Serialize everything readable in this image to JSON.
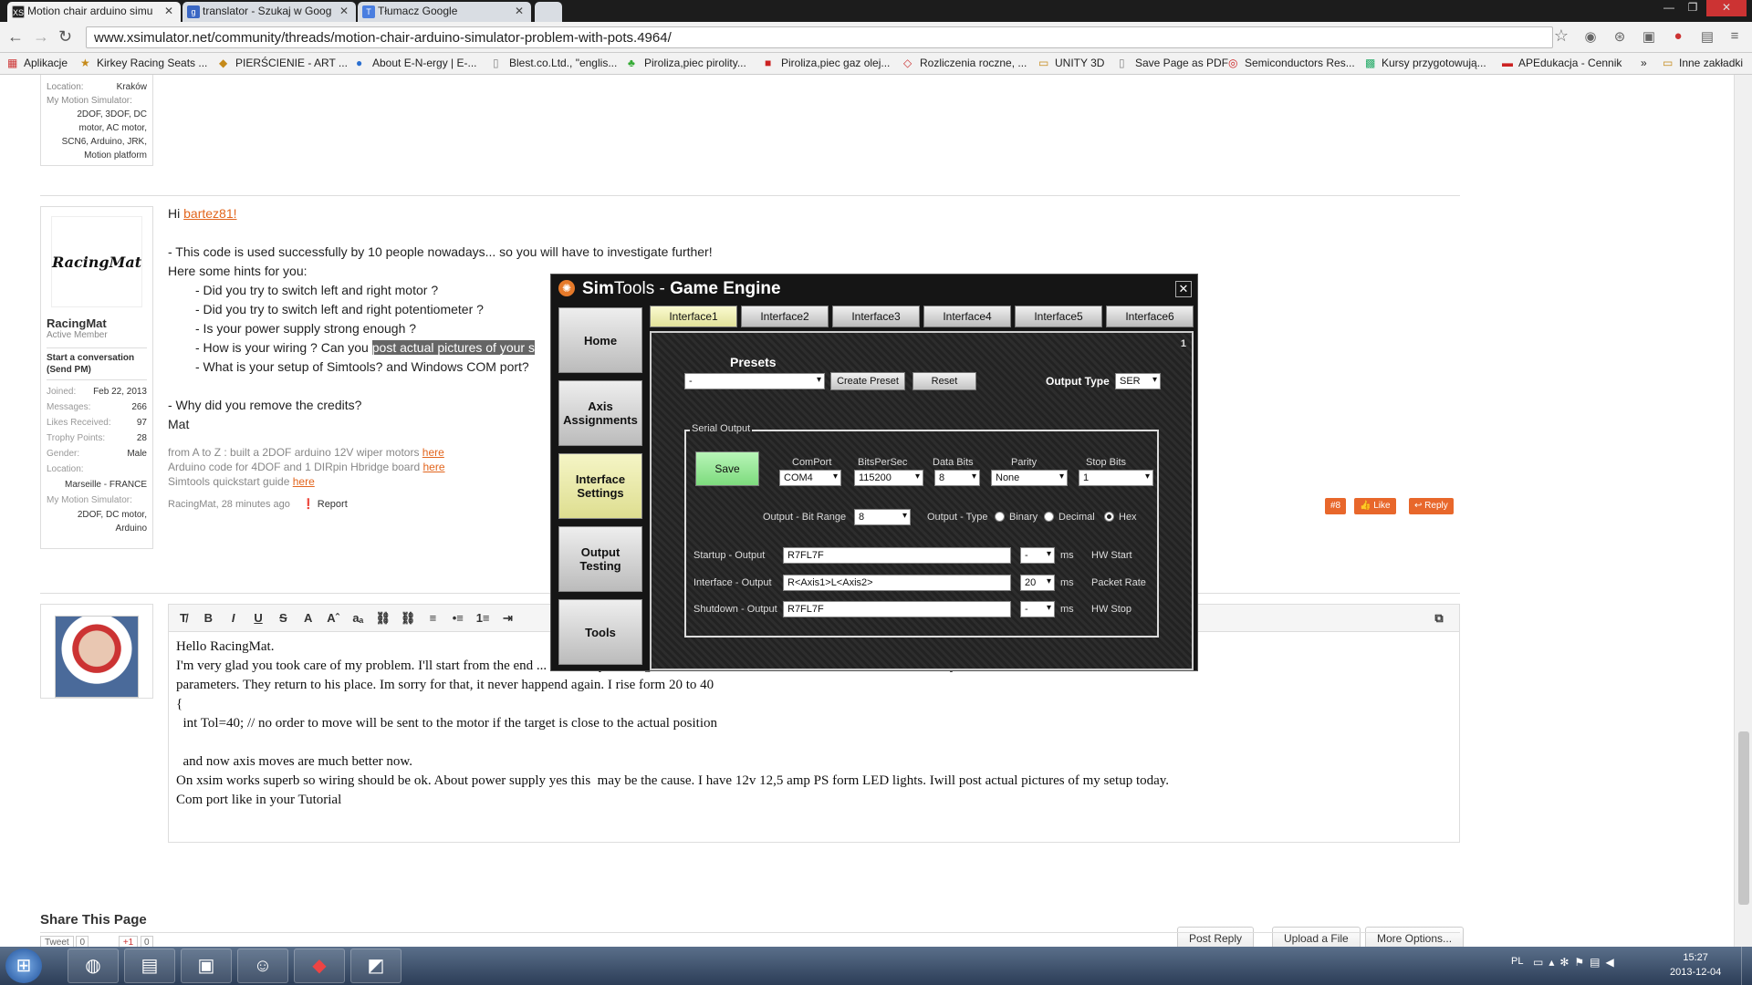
{
  "browser": {
    "tabs": [
      {
        "title": "Motion chair arduino simu",
        "icon": "xs"
      },
      {
        "title": "translator - Szukaj w Goog",
        "icon": "g"
      },
      {
        "title": "Tłumacz Google",
        "icon": "t"
      }
    ],
    "url": "www.xsimulator.net/community/threads/motion-chair-arduino-simulator-problem-with-pots.4964/",
    "bookmarks": [
      "Aplikacje",
      "Kirkey Racing Seats ...",
      "PIERŚCIENIE - ART ...",
      "About E-N-ergy | E-...",
      "Blest.co.Ltd., \"englis...",
      "Piroliza,piec pirolity...",
      "Piroliza,piec gaz olej...",
      "Rozliczenia roczne, ...",
      "UNITY 3D",
      "Save Page as PDF",
      "Semiconductors Res...",
      "Kursy przygotowują...",
      "APEdukacja - Cennik",
      "»",
      "Inne zakładki"
    ]
  },
  "top_user": {
    "location_label": "Location:",
    "location": "Kraków",
    "sim_label": "My Motion Simulator:",
    "sim": [
      "2DOF, 3DOF, DC",
      "motor, AC motor,",
      "SCN6, Arduino, JRK,",
      "Motion platform"
    ]
  },
  "post": {
    "avatar_text": "RacingMat",
    "username": "RacingMat",
    "role": "Active Member",
    "conversation": "Start a conversation (Send PM)",
    "stats": [
      {
        "label": "Joined:",
        "value": "Feb 22, 2013"
      },
      {
        "label": "Messages:",
        "value": "266"
      },
      {
        "label": "Likes Received:",
        "value": "97"
      },
      {
        "label": "Trophy Points:",
        "value": "28"
      },
      {
        "label": "Gender:",
        "value": "Male"
      }
    ],
    "location_label": "Location:",
    "location": "Marseille - FRANCE",
    "sim_label": "My Motion Simulator:",
    "sim": [
      "2DOF, DC motor,",
      "Arduino"
    ],
    "greeting": "Hi ",
    "mention": "bartez81!",
    "lines": [
      "- This code is used successfully by 10 people nowadays... so you will have to investigate further!",
      "Here some hints for you:",
      "- Did you try to switch left and right motor ?",
      "- Did you try to switch left and right potentiometer ?",
      "- Is your power supply strong enough ?",
      "- How is your wiring ? Can you ",
      "- What is your setup of Simtools? and Windows COM port?",
      "- Why did you remove the credits?",
      "Mat"
    ],
    "highlight": "post actual pictures of your s",
    "signature": [
      {
        "text": "from A to Z : built a 2DOF arduino 12V wiper motors ",
        "link": "here"
      },
      {
        "text": "Arduino code for 4DOF and 1 DIRpin Hbridge board ",
        "link": "here"
      },
      {
        "text": "Simtools quickstart guide ",
        "link": "here"
      }
    ],
    "meta": "RacingMat, 28 minutes ago",
    "report": "Report",
    "post_no": "#8",
    "like": "Like",
    "reply": "Reply"
  },
  "reply": {
    "lines": [
      "Hello RacingMat.",
      "I'm very glad you took care of my problem. I'll start from the end ... it's a simple change for me ... the code ... for me to understand and modify its",
      "parameters. They return to his place. Im sorry for that, it never happend again. I rise form 20 to 40",
      "{",
      "  int Tol=40; // no order to move will be sent to the motor if the target is close to the actual position",
      "",
      "  and now axis moves are much better now.",
      "On xsim works superb so wiring should be ok. About power supply yes this  may be the cause. I have 12v 12,5 amp PS form LED lights. Iwill post actual pictures of my setup today.",
      "Com port like in your Tutorial"
    ],
    "buttons": [
      "Post Reply",
      "Upload a File",
      "More Options..."
    ]
  },
  "share": {
    "title": "Share This Page",
    "tweet": "Tweet",
    "tweet_count": "0",
    "gplus": "+1",
    "gplus_count": "0"
  },
  "simtools": {
    "title_light": "Sim",
    "title_rest": "Tools - ",
    "title_bold": "Game Engine",
    "sidebar": [
      "Home",
      "Axis Assignments",
      "Interface Settings",
      "Output Testing",
      "Tools"
    ],
    "tabs": [
      "Interface1",
      "Interface2",
      "Interface3",
      "Interface4",
      "Interface5",
      "Interface6"
    ],
    "panel_no": "1",
    "presets_label": "Presets",
    "preset_value": "-",
    "create_preset": "Create Preset",
    "reset": "Reset",
    "output_type_label": "Output Type",
    "output_type": "SER",
    "serial_output": "Serial Output",
    "save": "Save",
    "comport_label": "ComPort",
    "comport": "COM4",
    "bits_label": "BitsPerSec",
    "bits": "115200",
    "databits_label": "Data Bits",
    "databits": "8",
    "parity_label": "Parity",
    "parity": "None",
    "stopbits_label": "Stop Bits",
    "stopbits": "1",
    "bitrange_label": "Output - Bit Range",
    "bitrange": "8",
    "outtype_label": "Output - Type",
    "radio": [
      "Binary",
      "Decimal",
      "Hex"
    ],
    "startup_label": "Startup - Output",
    "startup": "R7FL7F",
    "startup_ms": "-",
    "interface_label": "Interface - Output",
    "interface": "R<Axis1>L<Axis2>",
    "interface_ms": "20",
    "shutdown_label": "Shutdown - Output",
    "shutdown": "R7FL7F",
    "shutdown_ms": "-",
    "ms": "ms",
    "hw_start": "HW Start",
    "packet_rate": "Packet Rate",
    "hw_stop": "HW Stop"
  },
  "taskbar": {
    "lang": "PL",
    "time": "15:27",
    "date": "2013-12-04"
  }
}
